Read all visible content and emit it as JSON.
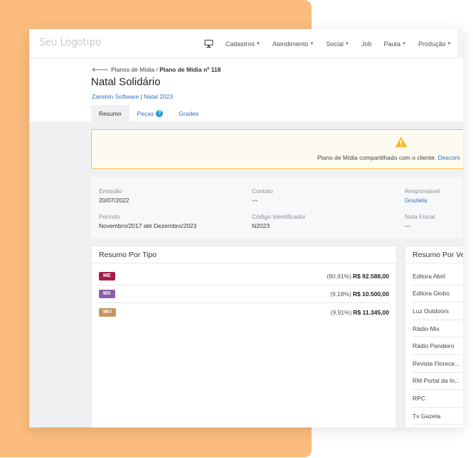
{
  "navbar": {
    "logo": "Seu Logotipo",
    "monitor_icon": "monitor-icon",
    "items": [
      {
        "label": "Cadastros",
        "dropdown": true
      },
      {
        "label": "Atendimento",
        "dropdown": true
      },
      {
        "label": "Social",
        "dropdown": true
      },
      {
        "label": "Job",
        "dropdown": false
      },
      {
        "label": "Pauta",
        "dropdown": true
      },
      {
        "label": "Produção",
        "dropdown": true
      },
      {
        "label": "Mí",
        "dropdown": false
      }
    ]
  },
  "header": {
    "breadcrumb_parent": "Planos de Mídia",
    "breadcrumb_separator": "/",
    "breadcrumb_current": "Plano de Mídia nº 118",
    "title": "Natal Solidário",
    "client": "Zanshin Software",
    "separator": "|",
    "campaign": "Natal 2023",
    "tabs": [
      {
        "label": "Resumo",
        "active": true
      },
      {
        "label": "Peças",
        "active": false,
        "help": "?"
      },
      {
        "label": "Grades",
        "active": false
      }
    ]
  },
  "alert": {
    "icon": "warning-icon",
    "text": "Plano de Mídia compartilhado com o cliente.",
    "link": "Descom"
  },
  "info": {
    "emissao_label": "Emissão",
    "emissao_value": "20/07/2022",
    "contato_label": "Contato",
    "contato_value": "---",
    "responsavel_label": "Responsável",
    "responsavel_value": "Graziela",
    "periodo_label": "Período",
    "periodo_value": "Novembro/2017 até Dezembro/2023",
    "codigo_label": "Código Identificador",
    "codigo_value": "N2023",
    "nota_label": "Nota Fiscal",
    "nota_value": "---"
  },
  "resumo_tipo": {
    "title": "Resumo Por Tipo",
    "rows": [
      {
        "badge": "ME",
        "color": "#a31f4a",
        "pct": "(80,91%)",
        "value": "R$ 92.588,00"
      },
      {
        "badge": "MX",
        "color": "#8e5ea8",
        "pct": "(9,18%)",
        "value": "R$ 10.500,00"
      },
      {
        "badge": "MI-I",
        "color": "#c79562",
        "pct": "(9,91%)",
        "value": "R$ 11.345,00"
      }
    ]
  },
  "resumo_veiculo": {
    "title": "Resumo Por Ve",
    "rows": [
      "Editora Abril",
      "Editora Globo",
      "Luz Outdoors",
      "Rádio Mix",
      "Rádio Pandeiro",
      "Revista Florece...",
      "RM Portal da In...",
      "RPC",
      "Tv Gazeta"
    ]
  }
}
